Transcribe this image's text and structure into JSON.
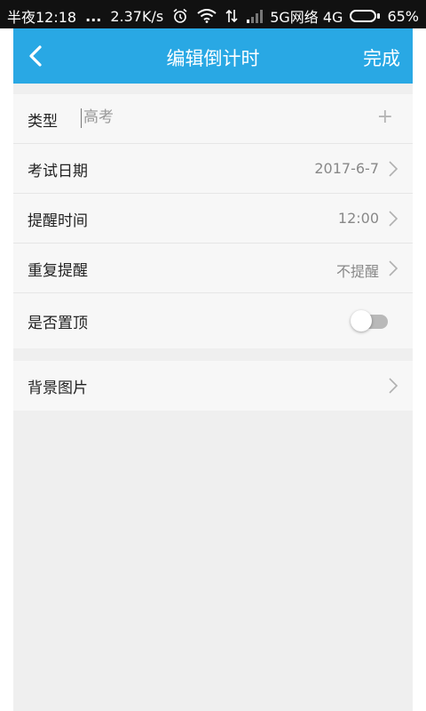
{
  "status_bar": {
    "time": "半夜12:18",
    "dots": "...",
    "speed": "2.37K/s",
    "network_label": "5G网络 4G",
    "battery_percent": "65%",
    "battery_level": 0.65,
    "icons": [
      "alarm-icon",
      "wifi-icon",
      "data-arrows-icon",
      "signal-icon",
      "battery-icon"
    ]
  },
  "header": {
    "title": "编辑倒计时",
    "done_label": "完成",
    "back_icon": "back-chevron-icon",
    "color": "#29a8e4"
  },
  "form": {
    "type": {
      "label": "类型",
      "value": "高考",
      "add_icon": "plus-icon"
    },
    "exam_date": {
      "label": "考试日期",
      "value": "2017-6-7"
    },
    "reminder_time": {
      "label": "提醒时间",
      "value": "12:00"
    },
    "repeat_reminder": {
      "label": "重复提醒",
      "value": "不提醒"
    },
    "pin_top": {
      "label": "是否置顶",
      "enabled": false
    },
    "background_image": {
      "label": "背景图片"
    }
  }
}
